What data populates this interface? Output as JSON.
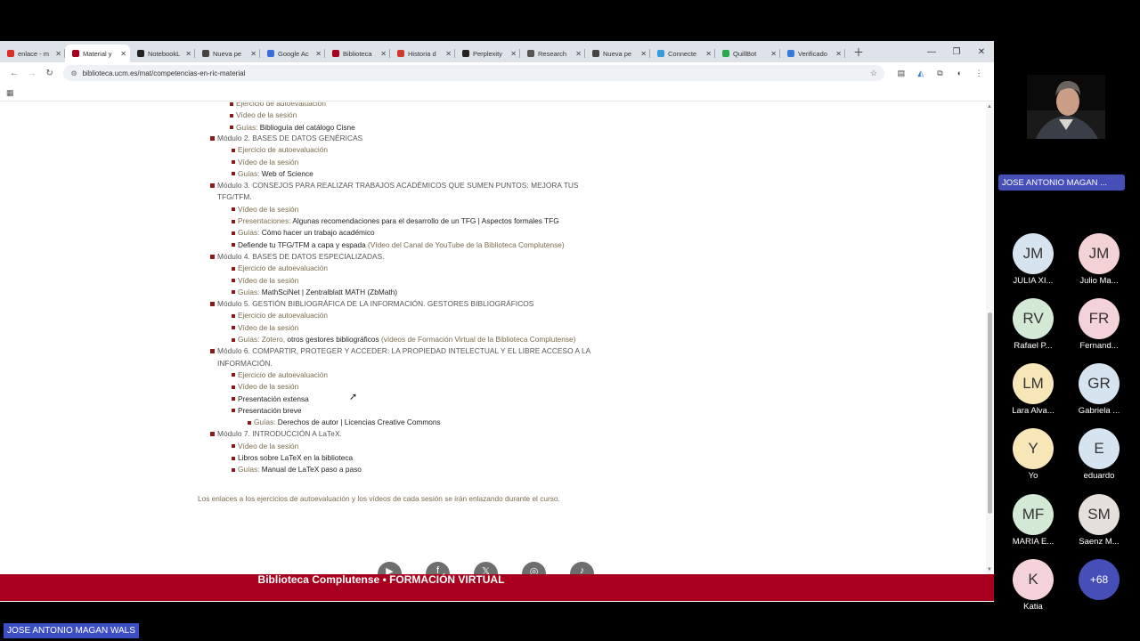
{
  "browser": {
    "tabs": [
      {
        "label": "enlace - m",
        "color": "#d93025"
      },
      {
        "label": "Material y",
        "color": "#a8001e",
        "active": true
      },
      {
        "label": "NotebookL",
        "color": "#222222"
      },
      {
        "label": "Nueva pe",
        "color": "#444444"
      },
      {
        "label": "Google Ac",
        "color": "#3c6ed8"
      },
      {
        "label": "Biblioteca",
        "color": "#a8001e"
      },
      {
        "label": "Historia d",
        "color": "#d03a2b"
      },
      {
        "label": "Perplexity",
        "color": "#222222"
      },
      {
        "label": "Research",
        "color": "#555555"
      },
      {
        "label": "Nueva pe",
        "color": "#444444"
      },
      {
        "label": "Connecte",
        "color": "#3a9ad9"
      },
      {
        "label": "QuillBot",
        "color": "#2ba84a"
      },
      {
        "label": "Verificado",
        "color": "#3a7ad9"
      }
    ],
    "new_tab_icon": "plus-icon",
    "url": "biblioteca.ucm.es/mat/competencias-en-ric-material"
  },
  "page": {
    "first_items": [
      {
        "lead": "Ejercicio de autoevaluación",
        "dark": ""
      },
      {
        "lead": "Vídeo de la sesión",
        "dark": ""
      },
      {
        "lead": "Guías: ",
        "dark": "Biblioguía del catálogo Cisne"
      }
    ],
    "modules": [
      {
        "title": "Módulo 2. BASES DE DATOS GENÉRICAS",
        "items": [
          {
            "lead": "Ejercicio de autoevaluación",
            "dark": ""
          },
          {
            "lead": "Vídeo de la sesión",
            "dark": ""
          },
          {
            "lead": "Guías: ",
            "dark": "Web of Science"
          }
        ]
      },
      {
        "title": "Módulo 3. CONSEJOS PARA REALIZAR TRABAJOS ACADÉMICOS QUE SUMEN PUNTOS: MEJORA TUS TFG/TFM.",
        "items": [
          {
            "lead": "Vídeo de la sesión",
            "dark": ""
          },
          {
            "lead": "Presentaciones: ",
            "dark": "Algunas recomendaciones para el desarrollo de un TFG | Aspectos formales TFG"
          },
          {
            "lead": "Guías: ",
            "dark": "Cómo hacer un trabajo académico"
          },
          {
            "lead": "",
            "dark": "Defiende tu TFG/TFM a capa y espada",
            "tail": " (Vídeo del Canal de YouTube de la Biblioteca Complutense)"
          }
        ]
      },
      {
        "title": "Módulo 4. BASES DE DATOS ESPECIALIZADAS.",
        "items": [
          {
            "lead": "Ejercicio de autoevaluación",
            "dark": ""
          },
          {
            "lead": "Vídeo de la sesión",
            "dark": ""
          },
          {
            "lead": "Guías: ",
            "dark": "MathSciNet | Zentralblatt MATH (ZbMath)"
          }
        ]
      },
      {
        "title": "Módulo 5. GESTIÓN BIBLIOGRÁFICA DE LA INFORMACIÓN. GESTORES BIBLIOGRÁFICOS",
        "items": [
          {
            "lead": "Ejercicio de autoevaluación",
            "dark": ""
          },
          {
            "lead": "Vídeo de la sesión",
            "dark": ""
          },
          {
            "lead": "Guías: Zotero, ",
            "dark": "otros gestores bibliográficos",
            "tail": " (vídeos de Formación Virtual de la Biblioteca Complutense)"
          }
        ]
      },
      {
        "title": "Módulo 6. COMPARTIR, PROTEGER Y ACCEDER: LA PROPIEDAD INTELECTUAL Y EL LIBRE ACCESO A LA INFORMACIÓN.",
        "items": [
          {
            "lead": "Ejercicio de autoevaluación",
            "dark": ""
          },
          {
            "lead": "Vídeo de la sesión",
            "dark": ""
          },
          {
            "lead": "",
            "dark": "Presentación extensa"
          },
          {
            "lead": "",
            "dark": "Presentación breve"
          }
        ],
        "subitem": {
          "lead": "Guías: ",
          "dark": "Derechos de autor | Licencias Creative Commons"
        }
      },
      {
        "title": "Módulo 7. INTRODUCCIÓN A LaTeX.",
        "items": [
          {
            "lead": "Vídeo de la sesión",
            "dark": ""
          },
          {
            "lead": "",
            "dark": "Libros sobre LaTeX en la biblioteca"
          },
          {
            "lead": "Guías: ",
            "dark": "Manual de LaTeX paso a paso"
          }
        ]
      }
    ],
    "note": "Los enlaces a los ejercicios de autoevaluación y los vídeos de cada sesión se irán enlazando durante el curso.",
    "social_icons": [
      "youtube-icon",
      "facebook-icon",
      "x-icon",
      "instagram-icon",
      "tiktok-icon"
    ],
    "footer_text": "Biblioteca Complutense • FORMACIÓN VIRTUAL",
    "brand_color": "#a8001e"
  },
  "meeting": {
    "speaker_name": "JOSE ANTONIO MAGAN ...",
    "presenter_label": "JOSE ANTONIO MAGAN WALS",
    "participants": [
      {
        "initials": "JM",
        "name": "JULIA XI...",
        "color": "#d6e4ef"
      },
      {
        "initials": "JM",
        "name": "Julio Ma...",
        "color": "#f3d2d5"
      },
      {
        "initials": "RV",
        "name": "Rafael P...",
        "color": "#d3e8d5"
      },
      {
        "initials": "FR",
        "name": "Fernand...",
        "color": "#f3d2d9"
      },
      {
        "initials": "LM",
        "name": "Lara Alva...",
        "color": "#f7e6b8"
      },
      {
        "initials": "GR",
        "name": "Gabriela ...",
        "color": "#d6e4ef"
      },
      {
        "initials": "Y",
        "name": "Yo",
        "color": "#f7e6b8"
      },
      {
        "initials": "E",
        "name": "eduardo",
        "color": "#d6e4ef"
      },
      {
        "initials": "MF",
        "name": "MARIA E...",
        "color": "#d3e8d5"
      },
      {
        "initials": "SM",
        "name": "Saenz M...",
        "color": "#e6e0dc"
      },
      {
        "initials": "K",
        "name": "Katia",
        "color": "#f3d2d9"
      }
    ],
    "more_count": "+68"
  }
}
